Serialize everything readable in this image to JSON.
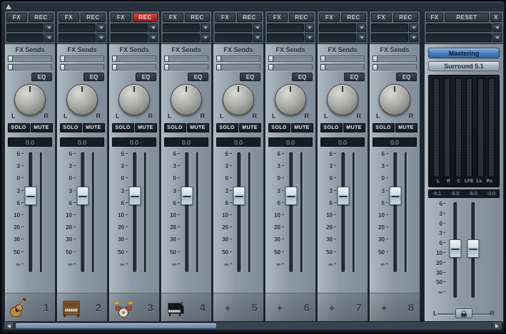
{
  "colors": {
    "accent_blue": "#4a7ab8",
    "record_red": "#c23434",
    "fader_cap": "#cfdde6"
  },
  "fader_scale": [
    "6",
    "3",
    "0",
    "3",
    "6",
    "10",
    "20",
    "30",
    "50",
    "∞"
  ],
  "channels": [
    {
      "num": "1",
      "icon": "guitar",
      "icon_label": "",
      "fx": "FX",
      "rec": "REC",
      "rec_active": false,
      "fx_sends": "FX Sends",
      "eq": "EQ",
      "pan_left": "L",
      "pan_right": "R",
      "solo": "SOLO",
      "mute": "MUTE",
      "value": "0.0"
    },
    {
      "num": "2",
      "icon": "organ",
      "icon_label": "",
      "fx": "FX",
      "rec": "REC",
      "rec_active": false,
      "fx_sends": "FX Sends",
      "eq": "EQ",
      "pan_left": "L",
      "pan_right": "R",
      "solo": "SOLO",
      "mute": "MUTE",
      "value": "0.0"
    },
    {
      "num": "3",
      "icon": "drums",
      "icon_label": "",
      "fx": "FX",
      "rec": "REC",
      "rec_active": true,
      "fx_sends": "FX Sends",
      "eq": "EQ",
      "pan_left": "L",
      "pan_right": "R",
      "solo": "SOLO",
      "mute": "MUTE",
      "value": "0.0"
    },
    {
      "num": "4",
      "icon": "piano",
      "icon_label": "",
      "fx": "FX",
      "rec": "REC",
      "rec_active": false,
      "fx_sends": "FX Sends",
      "eq": "EQ",
      "pan_left": "L",
      "pan_right": "R",
      "solo": "SOLO",
      "mute": "MUTE",
      "value": "0.0"
    },
    {
      "num": "5",
      "icon": "plus",
      "icon_label": "+",
      "fx": "FX",
      "rec": "REC",
      "rec_active": false,
      "fx_sends": "FX Sends",
      "eq": "EQ",
      "pan_left": "L",
      "pan_right": "R",
      "solo": "SOLO",
      "mute": "MUTE",
      "value": "0.0"
    },
    {
      "num": "6",
      "icon": "plus",
      "icon_label": "+",
      "fx": "FX",
      "rec": "REC",
      "rec_active": false,
      "fx_sends": "FX Sends",
      "eq": "EQ",
      "pan_left": "L",
      "pan_right": "R",
      "solo": "SOLO",
      "mute": "MUTE",
      "value": "0.0"
    },
    {
      "num": "7",
      "icon": "plus",
      "icon_label": "+",
      "fx": "FX",
      "rec": "REC",
      "rec_active": false,
      "fx_sends": "FX Sends",
      "eq": "EQ",
      "pan_left": "L",
      "pan_right": "R",
      "solo": "SOLO",
      "mute": "MUTE",
      "value": "0.0"
    },
    {
      "num": "8",
      "icon": "plus",
      "icon_label": "+",
      "fx": "FX",
      "rec": "REC",
      "rec_active": false,
      "fx_sends": "FX Sends",
      "eq": "EQ",
      "pan_left": "L",
      "pan_right": "R",
      "solo": "SOLO",
      "mute": "MUTE",
      "value": "0.0"
    }
  ],
  "master": {
    "fx": "FX",
    "reset": "RESET",
    "close": "X",
    "mastering": "Mastering",
    "surround": "Surround 5.1",
    "meter_labels": [
      "L",
      "R",
      "C",
      "LFE",
      "Ls",
      "Rs"
    ],
    "levels": [
      "-9.1",
      "-6.0",
      "-6.0",
      "-3.0"
    ],
    "left": "L",
    "right": "R"
  }
}
